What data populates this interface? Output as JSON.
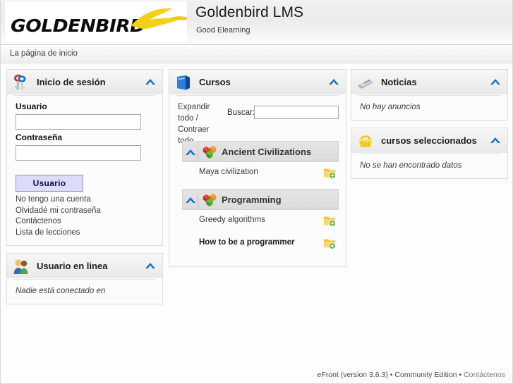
{
  "header": {
    "logo_text_gold": "GOLDEN",
    "logo_text_bird": "BIRD",
    "logo_icon": "bird-swoosh-logo",
    "title": "Goldenbird LMS",
    "subtitle": "Good Elearning"
  },
  "breadcrumb": {
    "current": "La página de inicio"
  },
  "login_panel": {
    "icon": "keys-icon",
    "title": "Inicio de sesión",
    "collapse_icon": "chevron-up-icon",
    "username_label": "Usuario",
    "username_value": "",
    "password_label": "Contraseña",
    "password_value": "",
    "submit_label": "Usuario",
    "links": [
      "No tengo una cuenta",
      "Olvidadé mi contraseña",
      "Contáctenos",
      "Lista de lecciones"
    ]
  },
  "online_panel": {
    "icon": "users-group-icon",
    "title": "Usuario en linea",
    "collapse_icon": "chevron-up-icon",
    "empty": "Nadie está conectado en"
  },
  "cursos_panel": {
    "icon": "blue-book-icon",
    "title": "Cursos",
    "collapse_icon": "chevron-up-icon",
    "expand_all": "Expandir todo /",
    "collapse_all": "Contraer todo",
    "search_label": "Buscar:",
    "search_value": "",
    "search_placeholder": "",
    "groups": [
      {
        "name": "Ancient Civilizations",
        "icon": "colored-cubes-icon",
        "collapse_icon": "chevron-up-icon",
        "lessons": [
          {
            "name": "Maya civilization",
            "bold": false,
            "action_icon": "folder-add-icon"
          }
        ]
      },
      {
        "name": "Programming",
        "icon": "colored-cubes-icon",
        "collapse_icon": "chevron-up-icon",
        "lessons": [
          {
            "name": "Greedy algorithms",
            "bold": false,
            "action_icon": "folder-add-icon"
          },
          {
            "name": "How to be a programmer",
            "bold": true,
            "action_icon": "folder-add-icon"
          }
        ]
      }
    ]
  },
  "noticias_panel": {
    "icon": "newspaper-icon",
    "title": "Noticias",
    "collapse_icon": "chevron-up-icon",
    "empty": "No hay anuncios"
  },
  "seleccionados_panel": {
    "icon": "basket-icon",
    "title": "cursos seleccionados",
    "collapse_icon": "chevron-up-icon",
    "empty": "No se han encontrado datos"
  },
  "footer": {
    "product": "eFront (version 3.6.3) • Community Edition • ",
    "contact": "Contáctenos"
  },
  "colors": {
    "accent_blue": "#1a6fc4",
    "button_bg": "#dcdcfa",
    "logo_yellow": "#f5d21e",
    "panel_border": "#dedede"
  }
}
